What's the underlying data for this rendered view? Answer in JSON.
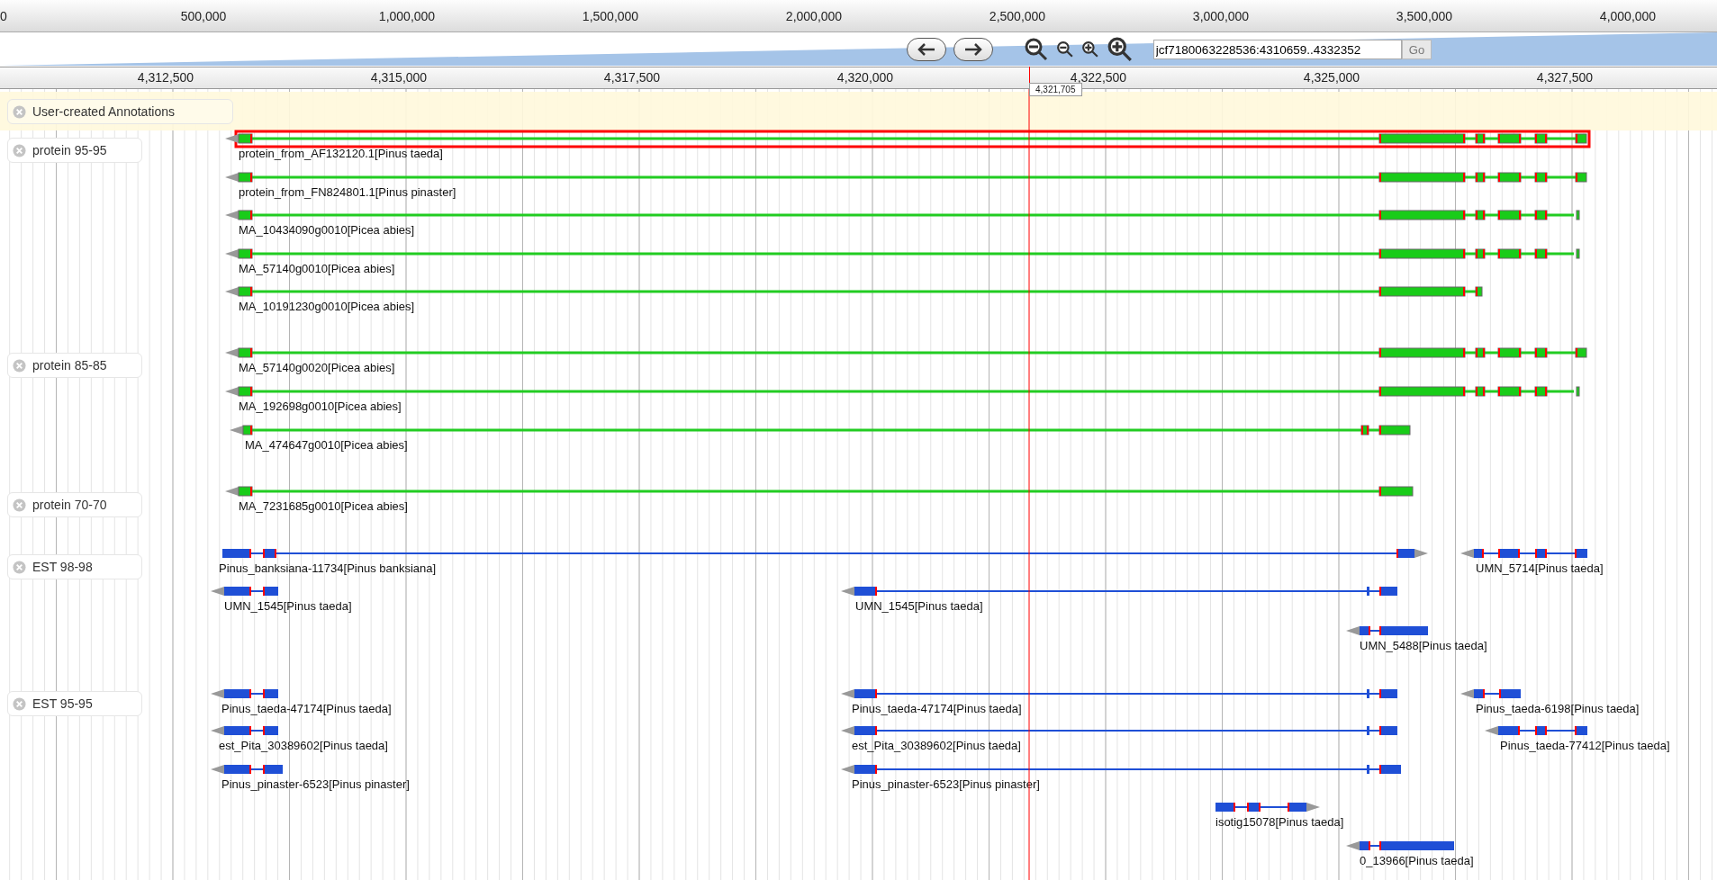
{
  "overview_ruler": {
    "ticks": [
      "0",
      "500,000",
      "1,000,000",
      "1,500,000",
      "2,000,000",
      "2,500,000",
      "3,000,000",
      "3,500,000",
      "4,000,000"
    ]
  },
  "navigation": {
    "location": "jcf7180063228536:4310659..4332352",
    "go_button": "Go"
  },
  "detail_ruler": {
    "ticks": [
      "4,312,500",
      "4,315,000",
      "4,317,500",
      "4,320,000",
      "4,322,500",
      "4,325,000",
      "4,327,500"
    ],
    "position_marker": "4,321,705"
  },
  "tracks": [
    {
      "label": "User-created Annotations",
      "kind": "user"
    },
    {
      "label": "protein 95-95",
      "kind": "protein",
      "features": [
        {
          "name": "protein_from_AF132120.1[Pinus taeda]",
          "selected": true
        },
        {
          "name": "protein_from_FN824801.1[Pinus pinaster]",
          "selected": false
        },
        {
          "name": "MA_10434090g0010[Picea abies]",
          "selected": false
        },
        {
          "name": "MA_57140g0010[Picea abies]",
          "selected": false
        },
        {
          "name": "MA_10191230g0010[Picea abies]",
          "selected": false
        }
      ]
    },
    {
      "label": "protein 85-85",
      "kind": "protein",
      "features": [
        {
          "name": "MA_57140g0020[Picea abies]",
          "selected": false
        },
        {
          "name": "MA_192698g0010[Picea abies]",
          "selected": false
        },
        {
          "name": "MA_474647g0010[Picea abies]",
          "selected": false
        }
      ]
    },
    {
      "label": "protein 70-70",
      "kind": "protein",
      "features": [
        {
          "name": "MA_7231685g0010[Picea abies]",
          "selected": false
        }
      ]
    },
    {
      "label": "EST 98-98",
      "kind": "est",
      "features": [
        {
          "name": "Pinus_banksiana-11734[Pinus banksiana]",
          "selected": false
        },
        {
          "name": "UMN_5714[Pinus taeda]",
          "selected": false
        },
        {
          "name": "UMN_1545[Pinus taeda]",
          "selected": false
        },
        {
          "name": "UMN_1545[Pinus taeda]",
          "selected": false
        },
        {
          "name": "UMN_5488[Pinus taeda]",
          "selected": false
        }
      ]
    },
    {
      "label": "EST 95-95",
      "kind": "est",
      "features": [
        {
          "name": "Pinus_taeda-47174[Pinus taeda]",
          "selected": false
        },
        {
          "name": "Pinus_taeda-47174[Pinus taeda]",
          "selected": false
        },
        {
          "name": "Pinus_taeda-6198[Pinus taeda]",
          "selected": false
        },
        {
          "name": "est_Pita_30389602[Pinus taeda]",
          "selected": false
        },
        {
          "name": "est_Pita_30389602[Pinus taeda]",
          "selected": false
        },
        {
          "name": "Pinus_taeda-77412[Pinus taeda]",
          "selected": false
        },
        {
          "name": "Pinus_pinaster-6523[Pinus pinaster]",
          "selected": false
        },
        {
          "name": "Pinus_pinaster-6523[Pinus pinaster]",
          "selected": false
        },
        {
          "name": "isotig15078[Pinus taeda]",
          "selected": false
        },
        {
          "name": "0_13966[Pinus taeda]",
          "selected": false
        }
      ]
    }
  ]
}
